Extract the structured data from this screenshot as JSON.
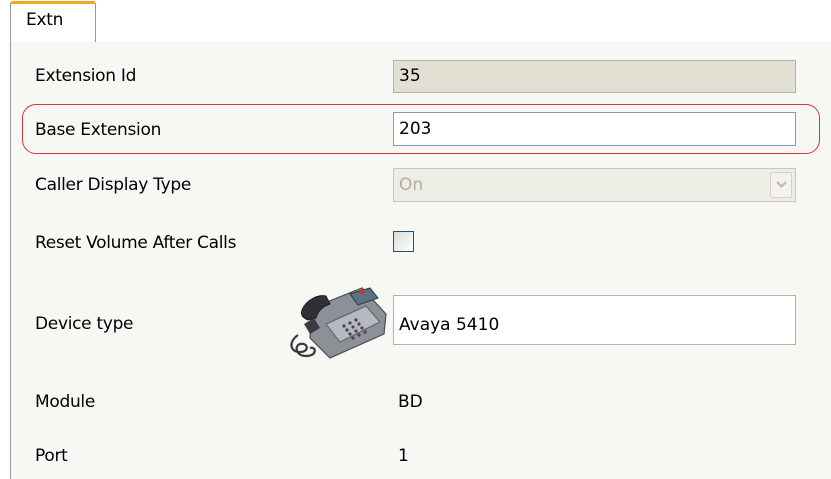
{
  "tab": {
    "label": "Extn"
  },
  "fields": {
    "extension_id": {
      "label": "Extension Id",
      "value": "35"
    },
    "base_extension": {
      "label": "Base Extension",
      "value": "203"
    },
    "caller_display_type": {
      "label": "Caller Display Type",
      "value": "On"
    },
    "reset_volume": {
      "label": "Reset Volume After Calls",
      "checked": false
    },
    "device_type": {
      "label": "Device type",
      "value": "Avaya 5410",
      "icon": "desk-phone-icon"
    },
    "module": {
      "label": "Module",
      "value": "BD"
    },
    "port": {
      "label": "Port",
      "value": "1"
    }
  },
  "colors": {
    "tab_accent": "#f5a623",
    "highlight_ring": "#d9343a",
    "panel_bg": "#f7f7f4",
    "readonly_bg": "#e1e0d3"
  }
}
